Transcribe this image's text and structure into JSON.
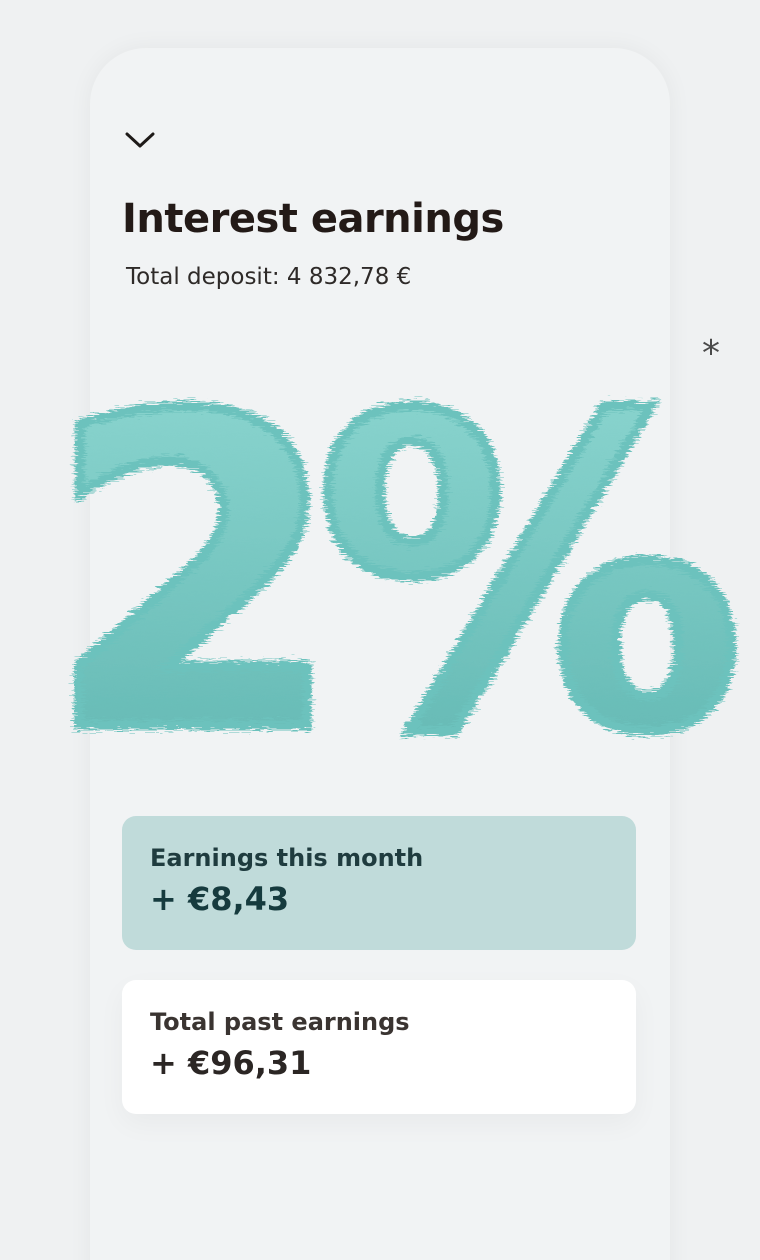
{
  "header": {
    "title": "Interest earnings",
    "subtitle": "Total deposit: 4 832,78 €",
    "collapse_icon": "chevron-down-icon"
  },
  "hero": {
    "rate_text": "2%",
    "rate_value": 2,
    "footnote_marker": "*",
    "color": "#7fcfca"
  },
  "cards": {
    "month": {
      "label": "Earnings this month",
      "value": "+ €8,43",
      "background": "#c0dbda"
    },
    "past": {
      "label": "Total past earnings",
      "value": "+ €96,31",
      "background": "#ffffff"
    }
  }
}
